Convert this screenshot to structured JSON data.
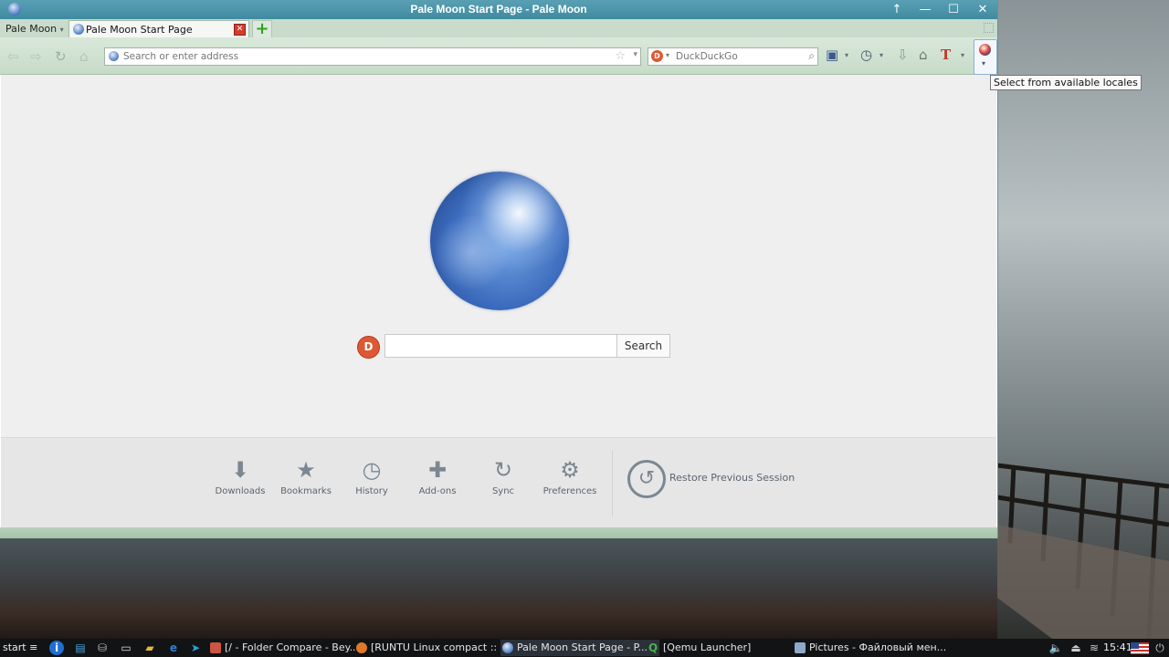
{
  "window": {
    "title": "Pale Moon Start Page - Pale Moon",
    "menu_button": "Pale Moon",
    "tab_label": "Pale Moon Start Page",
    "controls": {
      "up": "↑",
      "minimize": "—",
      "maximize": "☐",
      "close": "✕"
    }
  },
  "navbar": {
    "address_placeholder": "Search or enter address",
    "search_engine": "DuckDuckGo",
    "search_placeholder": "DuckDuckGo",
    "locale_tooltip": "Select from available locales"
  },
  "content": {
    "search_button": "Search",
    "shortcuts": [
      {
        "label": "Downloads",
        "icon": "download-icon"
      },
      {
        "label": "Bookmarks",
        "icon": "star-icon"
      },
      {
        "label": "History",
        "icon": "clock-icon"
      },
      {
        "label": "Add-ons",
        "icon": "puzzle-icon"
      },
      {
        "label": "Sync",
        "icon": "sync-icon"
      },
      {
        "label": "Preferences",
        "icon": "gear-icon"
      }
    ],
    "restore_label": "Restore Previous Session"
  },
  "taskbar": {
    "start_label": "start",
    "tasks": [
      {
        "label": "[/ - Folder Compare - Bey..."
      },
      {
        "label": "[RUNTU Linux compact :: ..."
      },
      {
        "label": "Pale Moon Start Page - P..."
      },
      {
        "label": "[Qemu Launcher]"
      },
      {
        "label": "Pictures - Файловый мен..."
      }
    ],
    "clock": "15:41"
  },
  "colors": {
    "titlebar": "#4a93a9",
    "toolbar": "#d0e2d2",
    "duckduckgo": "#de5833",
    "new_tab_plus": "#2ea51d"
  }
}
